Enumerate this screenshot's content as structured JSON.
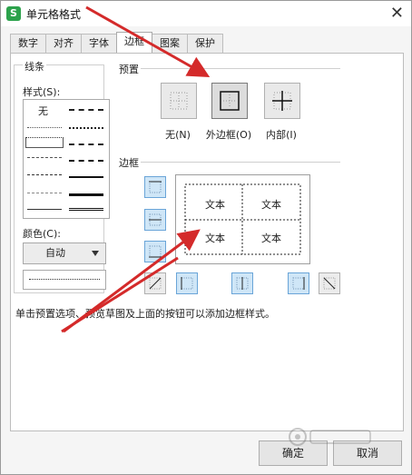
{
  "window": {
    "title": "单元格格式",
    "app_icon": "S",
    "close_glyph": "✕"
  },
  "tabs": [
    "数字",
    "对齐",
    "字体",
    "边框",
    "图案",
    "保护"
  ],
  "active_tab": "边框",
  "line": {
    "group_label": "线条",
    "style_label": "样式(S):",
    "none_label": "无",
    "color_label": "颜色(C):",
    "color_value": "自动"
  },
  "preset": {
    "group_label": "预置",
    "none": "无(N)",
    "outline": "外边框(O)",
    "inside": "内部(I)"
  },
  "border": {
    "group_label": "边框",
    "preview_cells": [
      "文本",
      "文本",
      "文本",
      "文本"
    ]
  },
  "hint": "单击预置选项、预览草图及上面的按钮可以添加边框样式。",
  "buttons": {
    "ok": "确定",
    "cancel": "取消"
  },
  "colors": {
    "arrow": "#d42a2a",
    "accent": "#2ca24c",
    "selected_border_btn": "#cfe6f7"
  }
}
